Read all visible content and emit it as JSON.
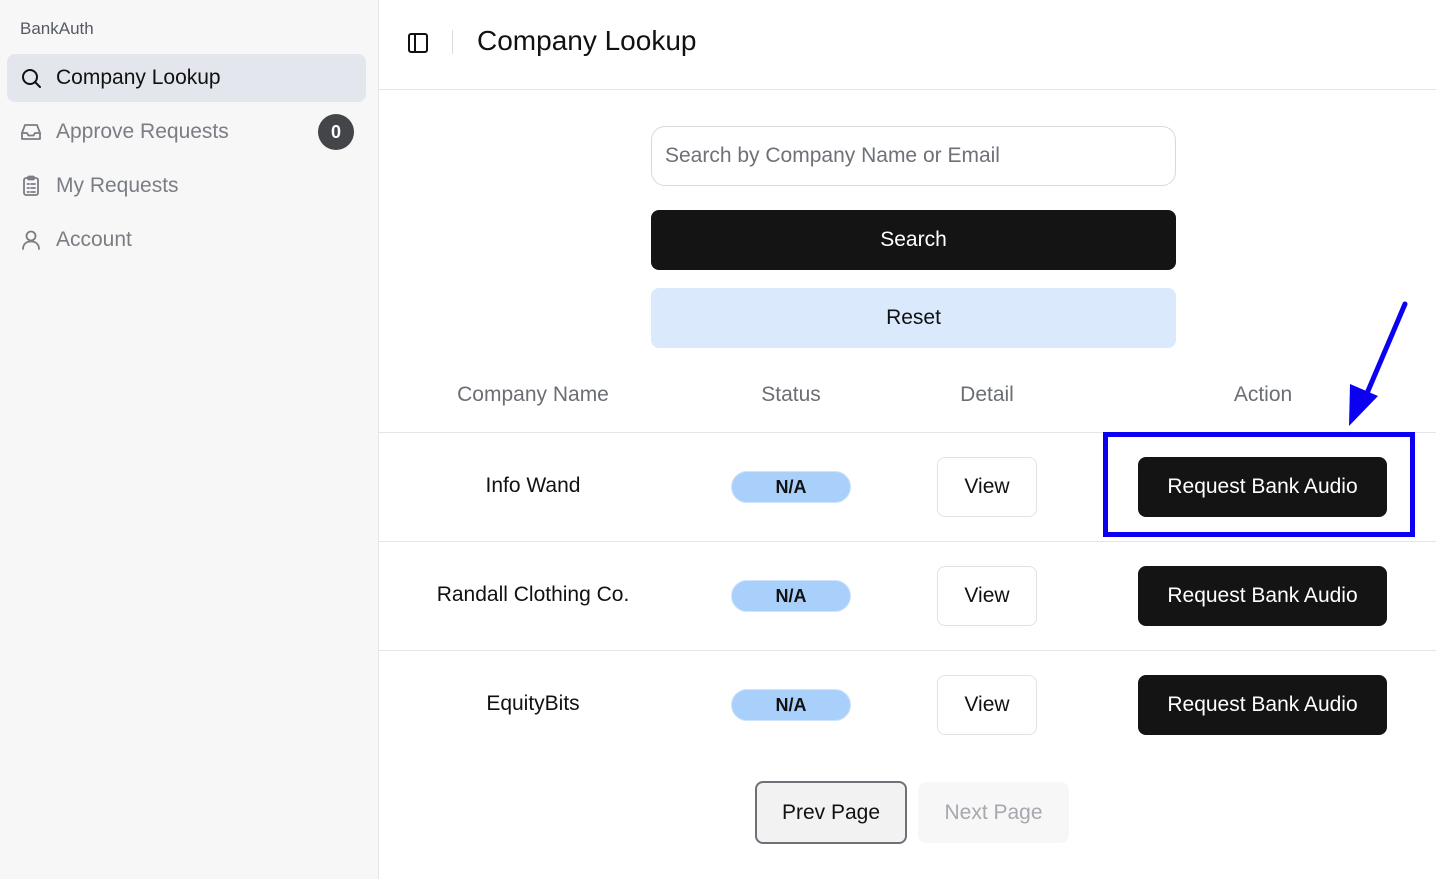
{
  "sidebar": {
    "brand": "BankAuth",
    "items": [
      {
        "label": "Company Lookup",
        "icon": "search-icon",
        "active": true
      },
      {
        "label": "Approve Requests",
        "icon": "inbox-icon",
        "badge": "0"
      },
      {
        "label": "My Requests",
        "icon": "clipboard-icon"
      },
      {
        "label": "Account",
        "icon": "user-icon"
      }
    ]
  },
  "header": {
    "title": "Company Lookup",
    "toggle_icon": "sidebar-toggle-icon"
  },
  "search": {
    "placeholder": "Search by Company Name or Email",
    "value": "",
    "search_label": "Search",
    "reset_label": "Reset"
  },
  "table": {
    "columns": [
      "Company Name",
      "Status",
      "Detail",
      "Action"
    ],
    "rows": [
      {
        "company": "Info Wand",
        "status": "N/A",
        "detail": "View",
        "action": "Request Bank Audio"
      },
      {
        "company": "Randall Clothing Co.",
        "status": "N/A",
        "detail": "View",
        "action": "Request Bank Audio"
      },
      {
        "company": "EquityBits",
        "status": "N/A",
        "detail": "View",
        "action": "Request Bank Audio"
      }
    ]
  },
  "pagination": {
    "prev_label": "Prev Page",
    "next_label": "Next Page"
  },
  "colors": {
    "primary_button": "#141414",
    "reset_button": "#dbe9fd",
    "status_pill": "#a9d0fb",
    "annotation": "#0b00f2"
  }
}
